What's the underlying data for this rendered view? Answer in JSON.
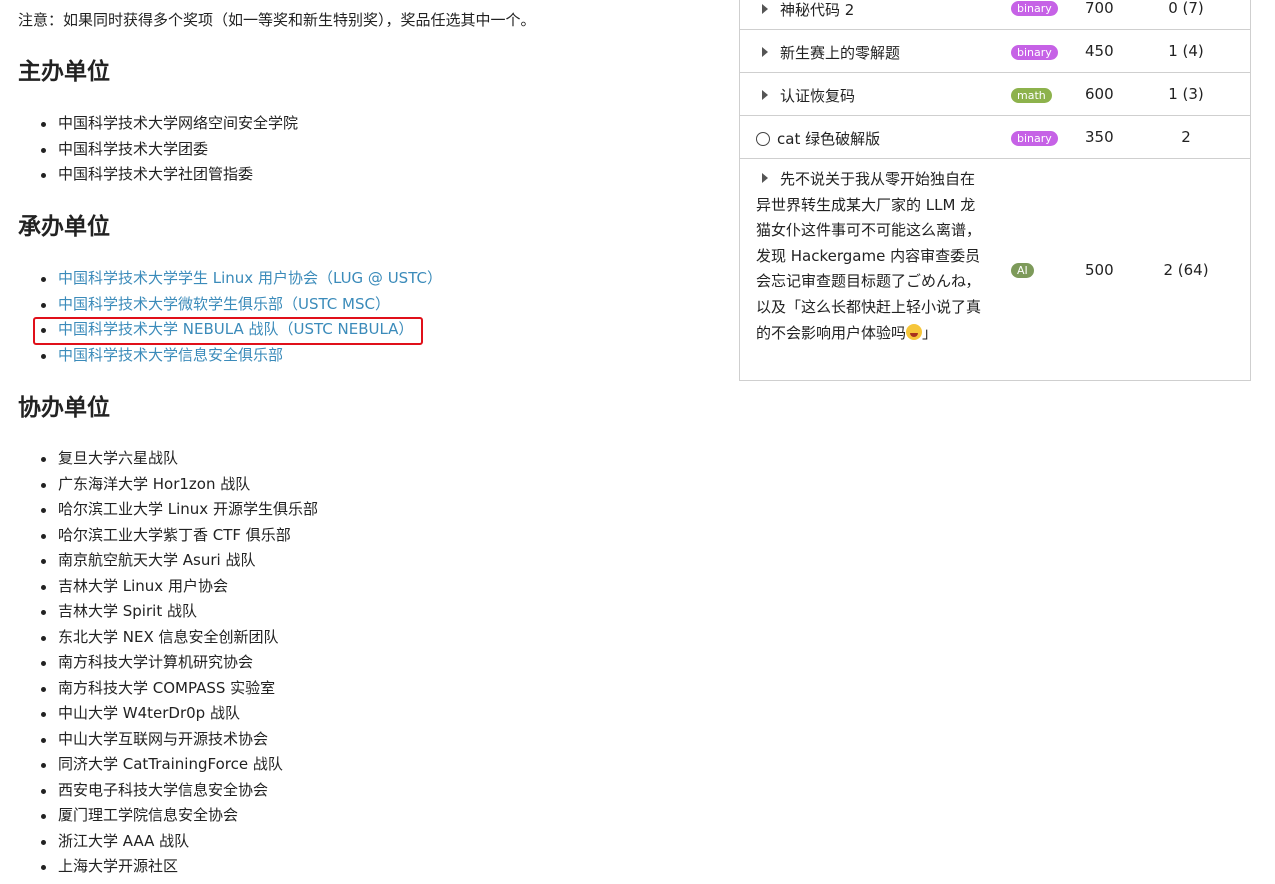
{
  "note": "注意：如果同时获得多个奖项（如一等奖和新生特别奖），奖品任选其中一个。",
  "sections": {
    "hosts": {
      "title": "主办单位",
      "items": [
        "中国科学技术大学网络空间安全学院",
        "中国科学技术大学团委",
        "中国科学技术大学社团管指委"
      ]
    },
    "organizers": {
      "title": "承办单位",
      "items": [
        "中国科学技术大学学生 Linux 用户协会（LUG @ USTC）",
        "中国科学技术大学微软学生俱乐部（USTC MSC）",
        "中国科学技术大学 NEBULA 战队（USTC NEBULA）",
        "中国科学技术大学信息安全俱乐部"
      ]
    },
    "coorganizers": {
      "title": "协办单位",
      "items": [
        "复旦大学六星战队",
        "广东海洋大学 Hor1zon 战队",
        "哈尔滨工业大学 Linux 开源学生俱乐部",
        "哈尔滨工业大学紫丁香 CTF 俱乐部",
        "南京航空航天大学 Asuri 战队",
        "吉林大学 Linux 用户协会",
        "吉林大学 Spirit 战队",
        "东北大学 NEX 信息安全创新团队",
        "南方科技大学计算机研究协会",
        "南方科技大学 COMPASS 实验室",
        "中山大学 W4terDr0p 战队",
        "中山大学互联网与开源技术协会",
        "同济大学 CatTrainingForce 战队",
        "西安电子科技大学信息安全协会",
        "厦门理工学院信息安全协会",
        "浙江大学 AAA 战队",
        "上海大学开源社区"
      ]
    }
  },
  "challenges": [
    {
      "name": "神秘代码 2",
      "tag": "binary",
      "score": "700",
      "solved": "0 (7)",
      "marker": "triangle"
    },
    {
      "name": "新生赛上的零解题",
      "tag": "binary",
      "score": "450",
      "solved": "1 (4)",
      "marker": "triangle"
    },
    {
      "name": "认证恢复码",
      "tag": "math",
      "score": "600",
      "solved": "1 (3)",
      "marker": "triangle"
    },
    {
      "name": "cat 绿色破解版",
      "tag": "binary",
      "score": "350",
      "solved": "2",
      "marker": "circle"
    },
    {
      "name": "先不说关于我从零开始独自在异世界转生成某大厂家的 LLM 龙猫女仆这件事可不可能这么离谱，发现 Hackergame 内容审查委员会忘记审查题目标题了ごめんね，以及「这么长都快赶上轻小说了真的不会影响用户体验吗",
      "name_end": "」",
      "tag": "AI",
      "score": "500",
      "solved": "2 (64)",
      "marker": "triangle"
    }
  ],
  "colors": {
    "link": "#3b8bba",
    "highlight": "#e0101a",
    "binary": "#c662e6",
    "math": "#8db24c",
    "ai": "#7d9a5a"
  }
}
